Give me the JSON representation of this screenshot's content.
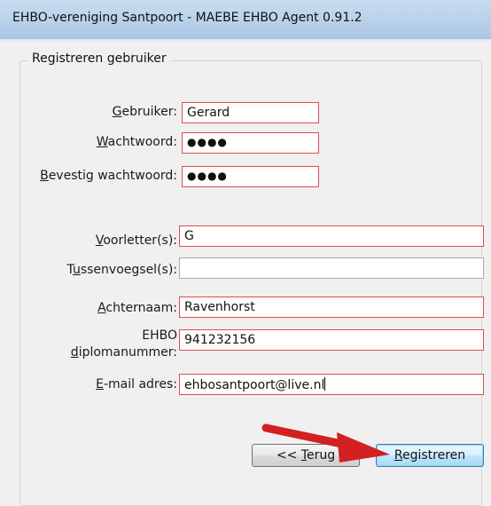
{
  "window": {
    "title": "EHBO-vereniging Santpoort - MAEBE EHBO Agent 0.91.2"
  },
  "form": {
    "legend": "Registreren gebruiker",
    "user": {
      "label_key": "G",
      "label_rest": "ebruiker:",
      "value": "Gerard"
    },
    "password": {
      "label_key": "W",
      "label_rest": "achtwoord:",
      "value": "●●●●"
    },
    "confirm": {
      "label_key": "B",
      "label_rest": "evestig wachtwoord:",
      "value": "●●●●"
    },
    "initials": {
      "label_key": "V",
      "label_rest": "oorletter(s):",
      "value": "G"
    },
    "infix": {
      "label_pre": "T",
      "label_key": "u",
      "label_rest": "ssenvoegsel(s):",
      "value": ""
    },
    "lastname": {
      "label_key": "A",
      "label_rest": "chternaam:",
      "value": "Ravenhorst"
    },
    "diploma": {
      "label_line1": "EHBO",
      "label_key": "d",
      "label_rest": "iplomanummer:",
      "value": "941232156"
    },
    "email": {
      "label_key": "E",
      "label_rest": "-mail adres:",
      "value": "ehbosantpoort@live.nl"
    }
  },
  "buttons": {
    "back": {
      "prefix": "<< ",
      "key": "T",
      "rest": "erug"
    },
    "register": {
      "key": "R",
      "rest": "egistreren"
    }
  },
  "colors": {
    "invalid_border": "#e24a4a",
    "annotation_arrow": "#d42020"
  }
}
